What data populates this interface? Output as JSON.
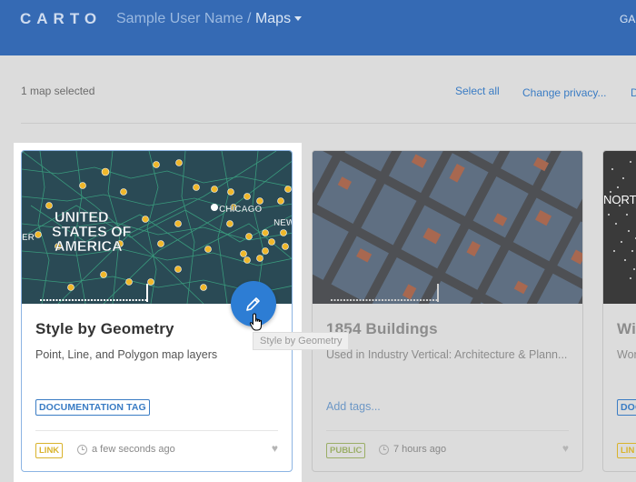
{
  "header": {
    "logo_text": "CARTO",
    "user_name": "Sample User Name /",
    "section": "Maps",
    "right_cut": "GA"
  },
  "toolbar": {
    "selected_count": "1 map selected",
    "select_all": "Select all",
    "change_privacy": "Change privacy...",
    "delete_cut": "D"
  },
  "cards": [
    {
      "title": "Style by Geometry",
      "description": "Point, Line, and Polygon map layers",
      "tag": "DOCUMENTATION TAG",
      "privacy": "LINK",
      "time": "a few seconds ago",
      "map_labels": [
        "UNITED",
        "STATES OF",
        "AMERICA",
        "CHICAGO",
        "NEW",
        "ER"
      ]
    },
    {
      "title": "1854 Buildings",
      "description": "Used in Industry Vertical: Architecture & Plann...",
      "add_tags": "Add tags...",
      "privacy": "PUBLIC",
      "time": "7 hours ago"
    },
    {
      "title": "Wi",
      "description": "Wor",
      "tag": "DOC",
      "privacy": "LIN",
      "map_labels": [
        "NORT"
      ]
    }
  ],
  "tooltip": "Style by Geometry",
  "colors": {
    "header": "#3b76c9",
    "accent": "#2d7dd4",
    "link": "#3a7cc4",
    "privacy_link": "#d9b32c",
    "privacy_public": "#9bae67"
  }
}
